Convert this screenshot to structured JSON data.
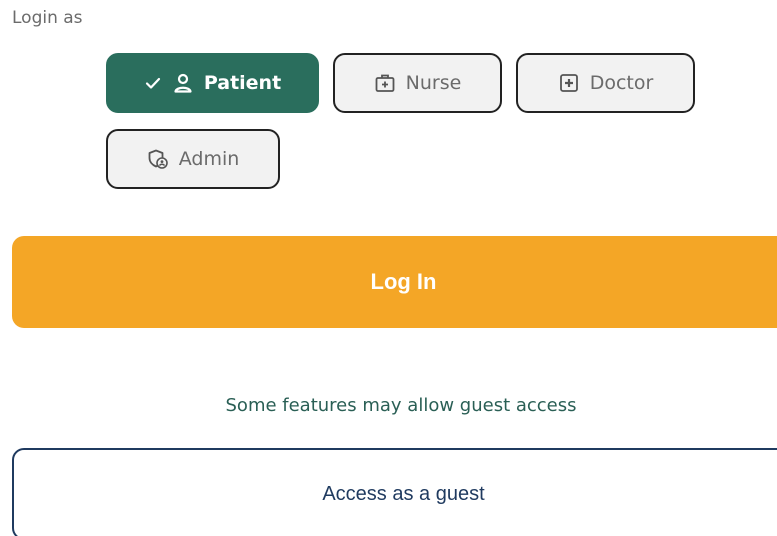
{
  "login_as": {
    "label": "Login as"
  },
  "roles": {
    "patient": {
      "label": "Patient",
      "selected": true
    },
    "nurse": {
      "label": "Nurse",
      "selected": false
    },
    "doctor": {
      "label": "Doctor",
      "selected": false
    },
    "admin": {
      "label": "Admin",
      "selected": false
    }
  },
  "actions": {
    "login_label": "Log In",
    "guest_note": "Some features may allow guest access",
    "guest_label": "Access as a guest"
  },
  "colors": {
    "selected_role": "#2a6e5d",
    "login_button": "#f4a626",
    "guest_border": "#1f3a5f",
    "guest_note_text": "#2a5f55"
  },
  "icons": {
    "patient": [
      "check-icon",
      "person-icon"
    ],
    "nurse": "medical-bag-icon",
    "doctor": "plus-square-icon",
    "admin": "shield-user-icon"
  }
}
